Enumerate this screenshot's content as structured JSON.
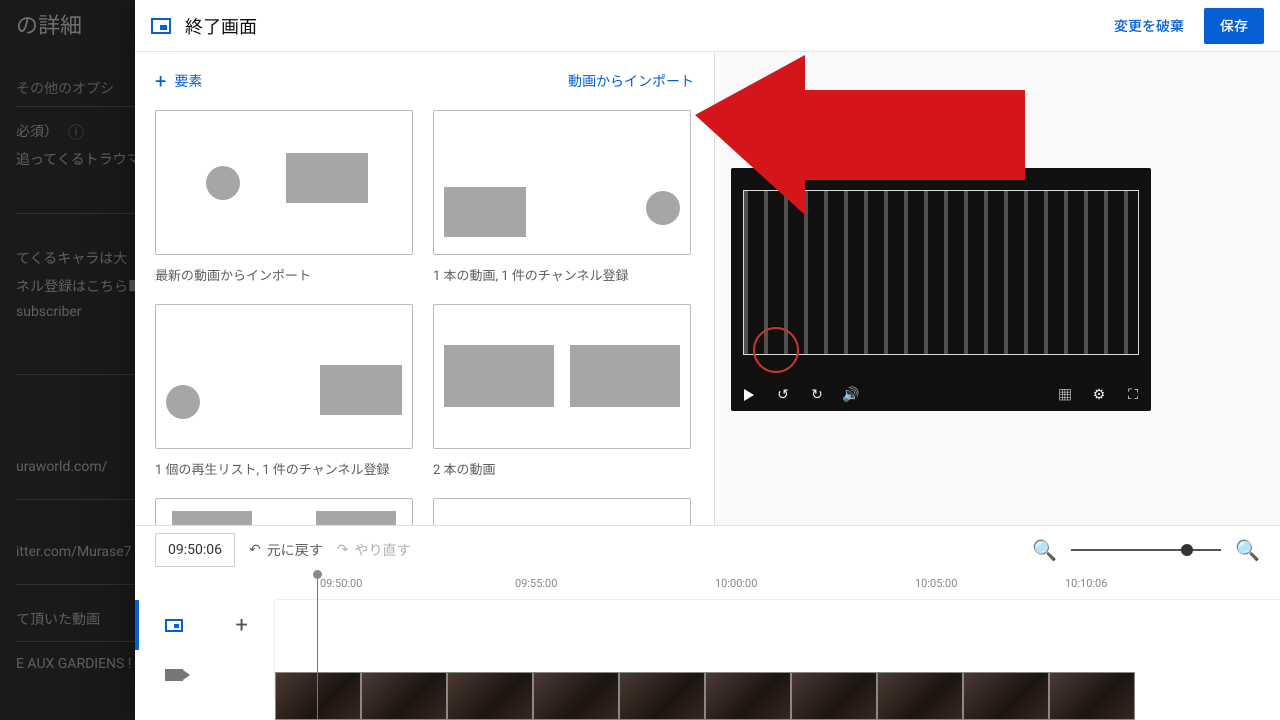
{
  "background": {
    "title": "の詳細",
    "sub": "その他のオプシ",
    "required": "必須）",
    "line1": "追ってくるトラウマ",
    "block2a": "てくるキャラは大",
    "block2b": "ネル登録はこちら■",
    "block2c": "subscriber",
    "link1": "uraworld.com/",
    "link2": "itter.com/Murase7",
    "tail1": "て頂いた動画",
    "tail2": "E AUX GARDIENS !"
  },
  "dialog": {
    "title": "終了画面",
    "discard": "変更を破棄",
    "save": "保存"
  },
  "toolbar": {
    "element": "要素",
    "import": "動画からインポート"
  },
  "templates": [
    "最新の動画からインポート",
    "1 本の動画, 1 件のチャンネル登録",
    "1 個の再生リスト, 1 件のチャンネル登録",
    "2 本の動画"
  ],
  "tl": {
    "timecode": "09:50:06",
    "undo": "元に戻す",
    "redo": "やり直す"
  },
  "ticks": [
    "09:50:00",
    "09:55:00",
    "10:00:00",
    "10:05:00",
    "10:10:06"
  ]
}
